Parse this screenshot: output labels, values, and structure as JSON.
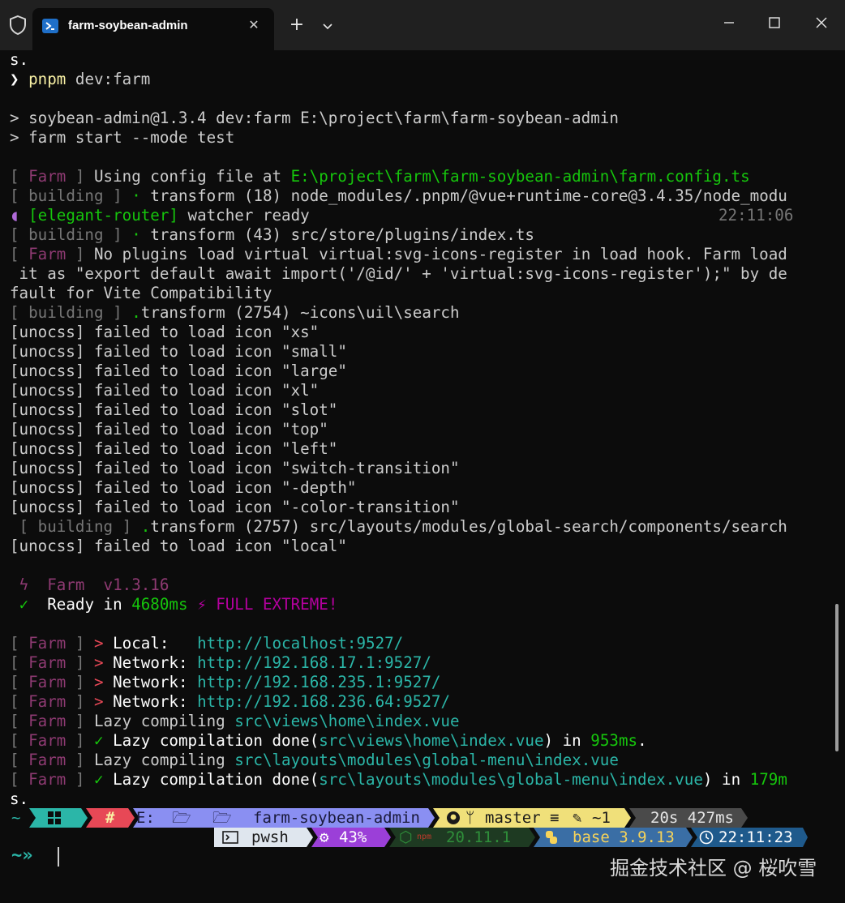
{
  "window": {
    "tab_title": "farm-soybean-admin",
    "tab_icon": "powershell-icon",
    "new_tab": "+",
    "close_glyph": "✕"
  },
  "terminal": {
    "l01": "s.",
    "l02_prompt": "❯",
    "l02_cmd": "pnpm",
    "l02_rest": " dev:farm",
    "l04": "> soybean-admin@1.3.4 dev:farm E:\\project\\farm\\farm-soybean-admin",
    "l05": "> farm start --mode test",
    "farm_tag": "Farm",
    "building_tag": "building",
    "l07_text": "Using config file at ",
    "l07_path": "E:\\project\\farm\\farm-soybean-admin\\farm.config.ts",
    "l08_text": "transform (18) node_modules/.pnpm/@vue+runtime-core@3.4.35/node_modu",
    "l09_tag": "[elegant-router]",
    "l09_text": " watcher ready",
    "l09_time": "22:11:06",
    "l10_text": "transform (43) src/store/plugins/index.ts",
    "l11_text": "No plugins load virtual virtual:svg-icons-register in load hook. Farm load",
    "l12": " it as \"export default await import('/@id/' + 'virtual:svg-icons-register');\" by de",
    "l13": "fault for Vite Compatibility",
    "l14_text": "transform (2754) ~icons\\uil\\search",
    "unocss_prefix": "[unocss] failed to load icon ",
    "unocss_icons": [
      "\"xs\"",
      "\"small\"",
      "\"large\"",
      "\"xl\"",
      "\"slot\"",
      "\"top\"",
      "\"left\"",
      "\"switch-transition\"",
      "\"-depth\"",
      "\"-color-transition\""
    ],
    "l25_text": "transform (2757) src/layouts/modules/global-search/components/search",
    "l26_icon": "\"local\"",
    "l28_glyph": "ϟ",
    "l28_text": "Farm  v1.3.16",
    "l29_check": "✓",
    "l29_ready": "Ready in ",
    "l29_ms": "4680ms",
    "l29_bolt": "⚡",
    "l29_mode": "FULL EXTREME!",
    "arrow": ">",
    "local_label": "Local:   ",
    "local_url": "http://localhost:9527/",
    "network_label": "Network: ",
    "network_urls": [
      "http://192.168.17.1:9527/",
      "http://192.168.235.1:9527/",
      "http://192.168.236.64:9527/"
    ],
    "lazy_compiling": "Lazy compiling ",
    "lazy_done": "Lazy compilation done(",
    "in": ") in ",
    "home_path": "src\\views\\home\\index.vue",
    "home_ms": "953ms",
    "home_tail": ".",
    "menu_path": "src\\layouts\\modules\\global-menu\\index.vue",
    "menu_ms": "179m",
    "l40": "s."
  },
  "prompt": {
    "tilde": "~",
    "hash": "#",
    "drive": "E:",
    "folder": "farm-soybean-admin",
    "branch": "master ≡",
    "changes": "~1",
    "duration": "20s 427ms",
    "shell": "pwsh",
    "cpu": "43%",
    "node": "20.11.1",
    "python": "base 3.9.13",
    "clock": "22:11:23",
    "input_arrows": "~»"
  },
  "watermark": "掘金技术社区 @ 桜吹雪",
  "colors": {
    "background": "#0c0c0c",
    "titlebar": "#202020",
    "farm_tag": "#8e3a72",
    "green": "#13a10e",
    "teal_segment": "#2bb6a8",
    "red_segment": "#e74856",
    "purple_segment": "#8a8ff2",
    "yellow_segment": "#f0e07a"
  }
}
